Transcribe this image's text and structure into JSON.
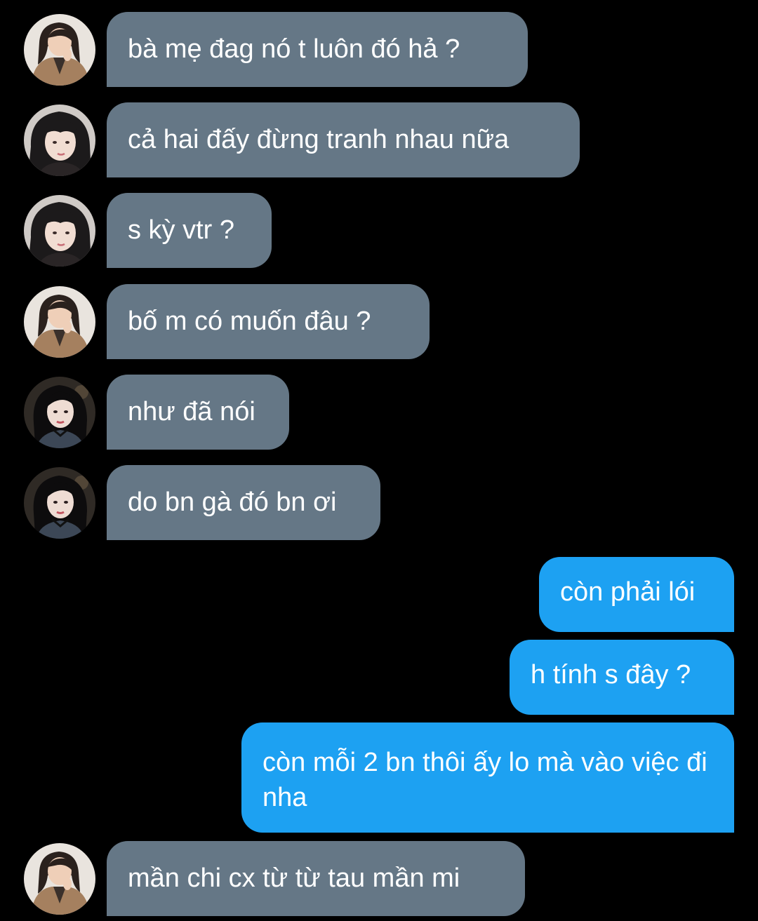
{
  "messages": [
    {
      "sender": "avatar-a",
      "text": "bà mẹ đag nó t luôn đó hả ?"
    },
    {
      "sender": "avatar-b",
      "text": "cả hai đấy đừng tranh nhau nữa"
    },
    {
      "sender": "avatar-b",
      "text": "s kỳ vtr ?"
    },
    {
      "sender": "avatar-a",
      "text": "bố m có muốn đâu ?"
    },
    {
      "sender": "avatar-c",
      "text": "như đã nói"
    },
    {
      "sender": "avatar-c",
      "text": "do bn gà đó bn ơi"
    },
    {
      "sender": "me",
      "text": "còn phải lói"
    },
    {
      "sender": "me",
      "text": "h tính s đây ?"
    },
    {
      "sender": "me",
      "text": "còn mỗi 2 bn thôi ấy lo mà vào việc đi nha"
    },
    {
      "sender": "avatar-a",
      "text": "mần chi cx từ từ tau mần mi"
    }
  ],
  "colors": {
    "background": "#000000",
    "incoming_bubble": "#657786",
    "outgoing_bubble": "#1da1f2",
    "text": "#ffffff"
  }
}
